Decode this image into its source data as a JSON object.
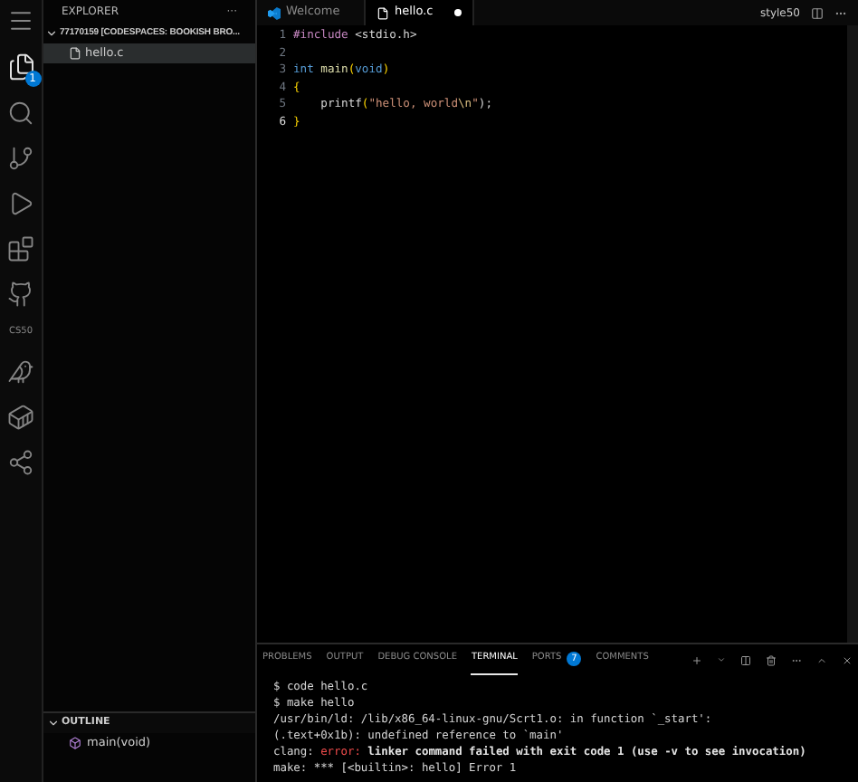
{
  "activity_bar": {
    "files_badge": "1",
    "cs50_label": "CS50"
  },
  "sidebar": {
    "title": "EXPLORER",
    "more": "···",
    "folder": {
      "label": "77170159 [CODESPACES: BOOKISH BRO...",
      "expanded": true,
      "children": [
        {
          "label": "hello.c",
          "selected": true
        }
      ]
    },
    "outline": {
      "title": "OUTLINE",
      "expanded": true,
      "items": [
        {
          "label": "main(void)"
        }
      ]
    }
  },
  "tabs": [
    {
      "label": "Welcome",
      "kind": "welcome",
      "selected": false,
      "modified": false
    },
    {
      "label": "hello.c",
      "kind": "file",
      "selected": true,
      "modified": true
    }
  ],
  "editor_actions": {
    "label": "style50"
  },
  "code": [
    {
      "number": "1",
      "active": false,
      "tokens": [
        {
          "text": "#include",
          "kind": "directive"
        },
        {
          "text": " <stdio.h>",
          "kind": "plain"
        }
      ]
    },
    {
      "number": "2",
      "active": false
    },
    {
      "number": "3",
      "active": false,
      "tokens": [
        {
          "text": "int ",
          "kind": "keyword"
        },
        {
          "text": "main",
          "kind": "func"
        },
        {
          "text": "(",
          "kind": "paren"
        },
        {
          "text": "void",
          "kind": "keyword"
        },
        {
          "text": ")",
          "kind": "paren"
        }
      ]
    },
    {
      "number": "4",
      "active": false,
      "tokens": [
        {
          "text": "{",
          "kind": "paren"
        }
      ]
    },
    {
      "number": "5",
      "active": false,
      "tokens": [
        {
          "text": "    printf",
          "kind": "plain"
        },
        {
          "text": "(",
          "kind": "paren"
        },
        {
          "text": "\"hello, world",
          "kind": "string"
        },
        {
          "text": "\\n",
          "kind": "escape"
        },
        {
          "text": "\"",
          "kind": "string"
        },
        {
          "text": ");",
          "kind": "plain"
        }
      ]
    },
    {
      "number": "6",
      "active": true,
      "tokens": [
        {
          "text": "}",
          "kind": "paren"
        }
      ]
    }
  ],
  "panel": {
    "tabs": [
      {
        "label": "PROBLEMS",
        "selected": false
      },
      {
        "label": "OUTPUT",
        "selected": false
      },
      {
        "label": "DEBUG CONSOLE",
        "selected": false
      },
      {
        "label": "TERMINAL",
        "selected": true
      },
      {
        "label": "PORTS",
        "selected": false,
        "badge": "7"
      },
      {
        "label": "COMMENTS",
        "selected": false
      }
    ],
    "terminal": [
      [
        {
          "text": "$ code hello.c",
          "kind": "plain"
        }
      ],
      [
        {
          "text": "$ make hello",
          "kind": "plain"
        }
      ],
      [
        {
          "text": "/usr/bin/ld: /lib/x86_64-linux-gnu/Scrt1.o: in function `_start':",
          "kind": "plain"
        }
      ],
      [
        {
          "text": "(.text+0x1b): undefined reference to `main'",
          "kind": "plain"
        }
      ],
      [
        {
          "text": "clang: ",
          "kind": "plain"
        },
        {
          "text": "error:",
          "kind": "error"
        },
        {
          "text": " linker command failed with exit code 1 (use -v to see invocation)",
          "kind": "bold"
        }
      ],
      [
        {
          "text": "make: *** [<builtin>: hello] Error 1",
          "kind": "plain"
        }
      ]
    ]
  }
}
